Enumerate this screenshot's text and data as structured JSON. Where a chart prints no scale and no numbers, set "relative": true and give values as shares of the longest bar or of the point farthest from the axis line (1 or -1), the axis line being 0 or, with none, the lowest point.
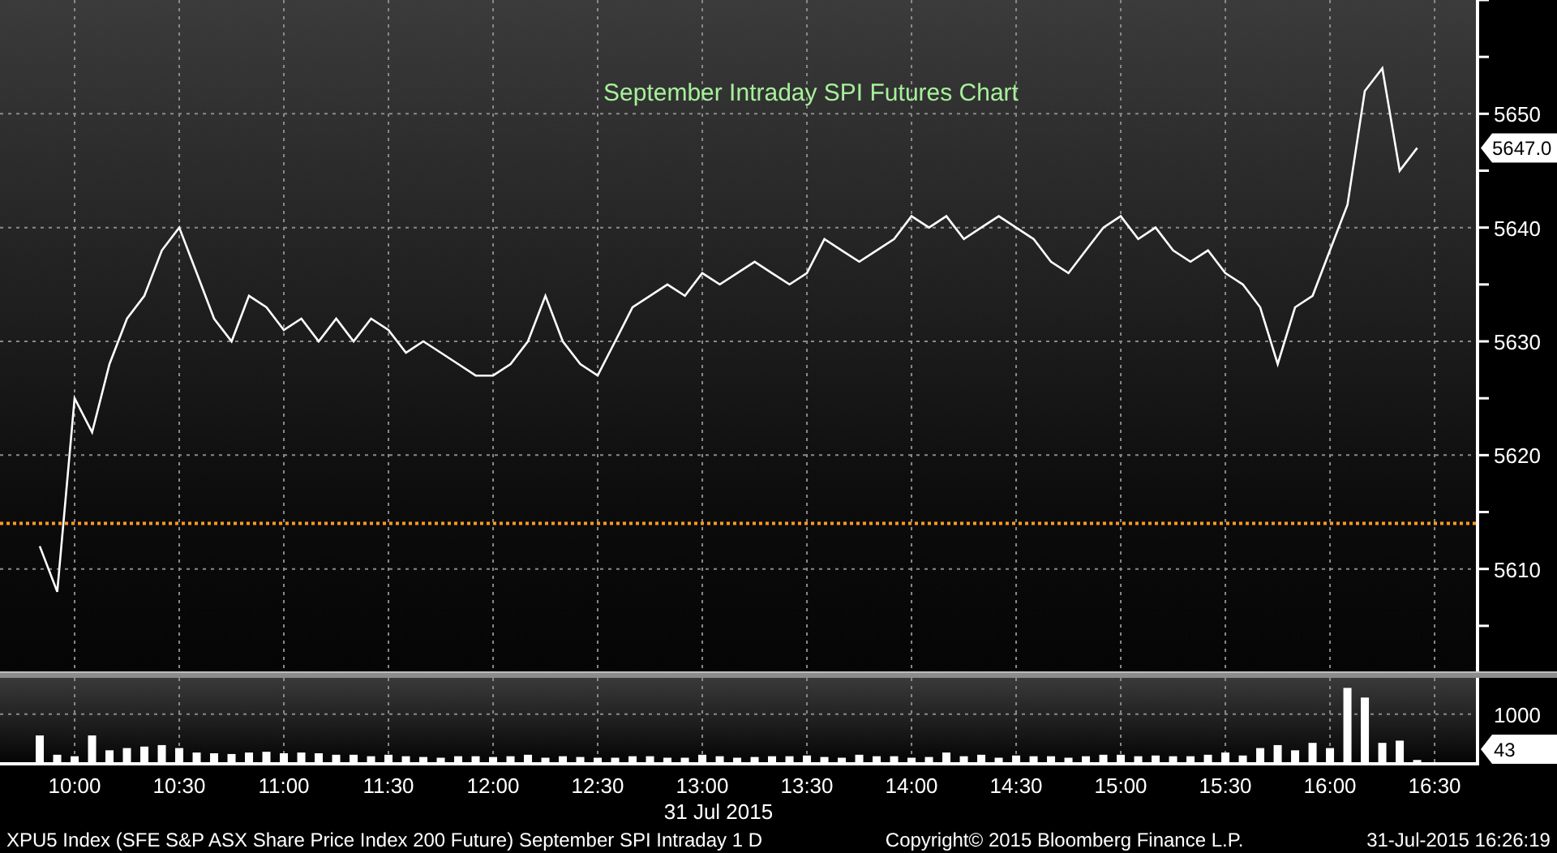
{
  "price_chart": {
    "chart_data": {
      "type": "line",
      "title": "September Intraday SPI Futures Chart",
      "grid": true,
      "x": [
        590,
        595,
        600,
        605,
        610,
        615,
        620,
        625,
        630,
        635,
        640,
        645,
        650,
        655,
        660,
        665,
        670,
        675,
        680,
        685,
        690,
        695,
        700,
        705,
        710,
        715,
        720,
        725,
        730,
        735,
        740,
        745,
        750,
        755,
        760,
        765,
        770,
        775,
        780,
        785,
        790,
        795,
        800,
        805,
        810,
        815,
        820,
        825,
        830,
        835,
        840,
        845,
        850,
        855,
        860,
        865,
        870,
        875,
        880,
        885,
        890,
        895,
        900,
        905,
        910,
        915,
        920,
        925,
        930,
        935,
        940,
        945,
        950,
        955,
        960,
        965,
        970,
        975,
        980,
        985
      ],
      "series": [
        {
          "color": "#ffffff",
          "values": [
            5612,
            5608,
            5625,
            5622,
            5628,
            5632,
            5634,
            5638,
            5640,
            5636,
            5632,
            5630,
            5634,
            5633,
            5631,
            5632,
            5630,
            5632,
            5630,
            5632,
            5631,
            5629,
            5630,
            5629,
            5628,
            5627,
            5627,
            5628,
            5630,
            5634,
            5630,
            5628,
            5627,
            5630,
            5633,
            5634,
            5635,
            5634,
            5636,
            5635,
            5636,
            5637,
            5636,
            5635,
            5636,
            5639,
            5638,
            5637,
            5638,
            5639,
            5641,
            5640,
            5641,
            5639,
            5640,
            5641,
            5640,
            5639,
            5637,
            5636,
            5638,
            5640,
            5641,
            5639,
            5640,
            5638,
            5637,
            5638,
            5636,
            5635,
            5633,
            5628,
            5633,
            5634,
            5638,
            5642,
            5652,
            5654,
            5645,
            5647
          ]
        }
      ],
      "xlim": [
        578.6,
        1025.1
      ],
      "ylim": [
        5601,
        5660
      ],
      "yticks": [
        5610,
        5620,
        5630,
        5640,
        5650
      ],
      "ref_lines": [
        {
          "axis": "y",
          "value": 5614,
          "color": "#ff9a1f"
        }
      ],
      "annotations": [
        "5647.0"
      ]
    }
  },
  "volume_chart": {
    "chart_data": {
      "type": "bar",
      "xlabel": "31 Jul 2015",
      "grid": true,
      "x": [
        590,
        595,
        600,
        605,
        610,
        615,
        620,
        625,
        630,
        635,
        640,
        645,
        650,
        655,
        660,
        665,
        670,
        675,
        680,
        685,
        690,
        695,
        700,
        705,
        710,
        715,
        720,
        725,
        730,
        735,
        740,
        745,
        750,
        755,
        760,
        765,
        770,
        775,
        780,
        785,
        790,
        795,
        800,
        805,
        810,
        815,
        820,
        825,
        830,
        835,
        840,
        845,
        850,
        855,
        860,
        865,
        870,
        875,
        880,
        885,
        890,
        895,
        900,
        905,
        910,
        915,
        920,
        925,
        930,
        935,
        940,
        945,
        950,
        955,
        960,
        965,
        970,
        975,
        980,
        985
      ],
      "values": [
        0.36,
        0.1,
        0.08,
        0.36,
        0.16,
        0.19,
        0.21,
        0.23,
        0.19,
        0.13,
        0.12,
        0.11,
        0.13,
        0.14,
        0.12,
        0.13,
        0.12,
        0.1,
        0.1,
        0.08,
        0.1,
        0.08,
        0.07,
        0.06,
        0.08,
        0.08,
        0.07,
        0.08,
        0.1,
        0.06,
        0.08,
        0.07,
        0.06,
        0.06,
        0.08,
        0.08,
        0.06,
        0.06,
        0.1,
        0.08,
        0.06,
        0.07,
        0.08,
        0.08,
        0.09,
        0.07,
        0.06,
        0.1,
        0.08,
        0.08,
        0.06,
        0.07,
        0.13,
        0.08,
        0.1,
        0.06,
        0.09,
        0.08,
        0.08,
        0.06,
        0.08,
        0.1,
        0.1,
        0.08,
        0.09,
        0.08,
        0.08,
        0.1,
        0.13,
        0.09,
        0.19,
        0.23,
        0.16,
        0.26,
        0.19,
        1,
        0.87,
        0.26,
        0.29,
        0.03
      ],
      "xlim": [
        578.6,
        1025.1
      ],
      "relative": true,
      "xticks": [
        {
          "value": 600,
          "label": "10:00"
        },
        {
          "value": 630,
          "label": "10:30"
        },
        {
          "value": 660,
          "label": "11:00"
        },
        {
          "value": 690,
          "label": "11:30"
        },
        {
          "value": 720,
          "label": "12:00"
        },
        {
          "value": 750,
          "label": "12:30"
        },
        {
          "value": 780,
          "label": "13:00"
        },
        {
          "value": 810,
          "label": "13:30"
        },
        {
          "value": 840,
          "label": "14:00"
        },
        {
          "value": 870,
          "label": "14:30"
        },
        {
          "value": 900,
          "label": "15:00"
        },
        {
          "value": 930,
          "label": "15:30"
        },
        {
          "value": 960,
          "label": "16:00"
        },
        {
          "value": 990,
          "label": "16:30"
        }
      ],
      "annotations": [
        "1000",
        "43"
      ]
    }
  },
  "footer": {
    "security": "XPU5 Index (SFE S&P ASX Share Price Index 200 Future) September SPI Intraday 1 D",
    "copyright": "Copyright© 2015 Bloomberg Finance L.P.",
    "timestamp": "31-Jul-2015 16:26:19"
  }
}
